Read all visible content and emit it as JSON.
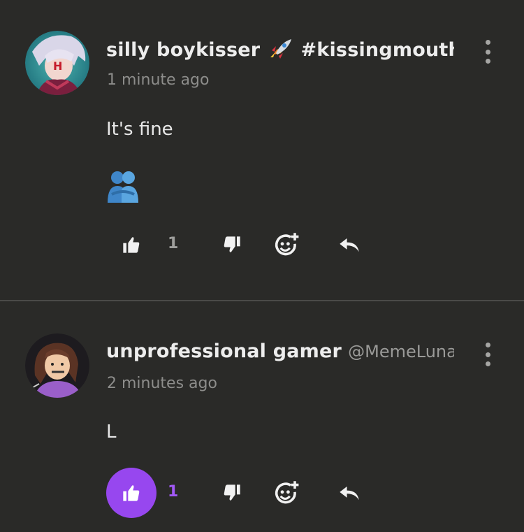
{
  "colors": {
    "background": "#2a2a28",
    "accent": "#9747ef",
    "divider": "#4a4a48",
    "muted_text": "#8d8d8b"
  },
  "comments": [
    {
      "author": "silly boykisser",
      "author_emoji": "rocket-emoji",
      "author_suffix": "#kissingmouths...",
      "handle": "",
      "time": "1 minute ago",
      "text": "It's fine",
      "attachment_emoji": "people-hugging-emoji",
      "like_count": "1",
      "liked": false,
      "avatar": "anime-avatar-white-hair"
    },
    {
      "author": "unprofessional gamer",
      "author_emoji": "",
      "author_suffix": "",
      "handle": "@MemeLunatic",
      "time": "2 minutes ago",
      "text": "L",
      "attachment_emoji": "",
      "like_count": "1",
      "liked": true,
      "avatar": "cartoon-avatar-brown-hair"
    }
  ],
  "icons": {
    "like": "thumbs-up-icon",
    "dislike": "thumbs-down-icon",
    "react": "add-reaction-icon",
    "reply": "reply-icon",
    "more": "more-vertical-icon"
  }
}
